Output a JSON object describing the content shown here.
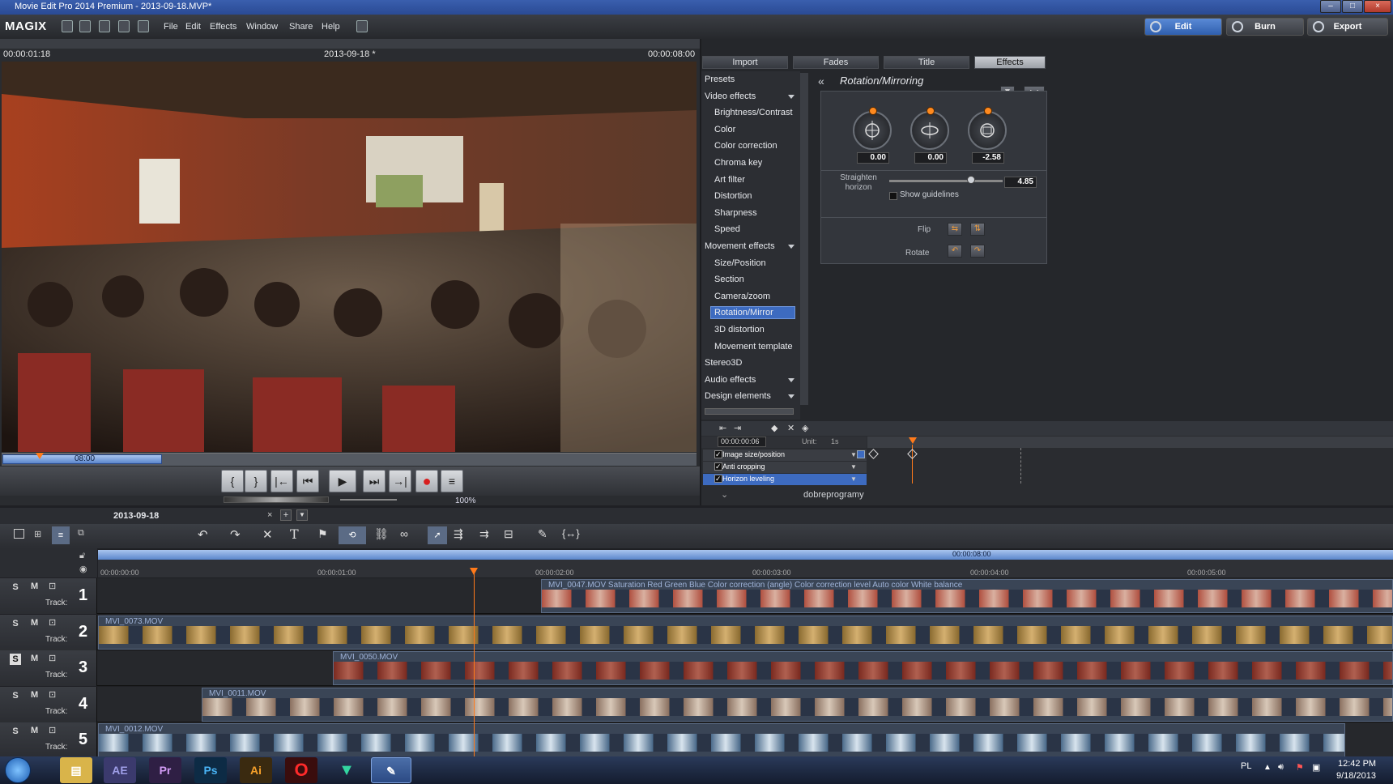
{
  "window": {
    "title": "Movie Edit Pro 2014 Premium - 2013-09-18.MVP*"
  },
  "menubar": {
    "logo": "MAGIX",
    "items": [
      "File",
      "Edit",
      "Effects",
      "Window",
      "Share",
      "Help"
    ],
    "modes": [
      {
        "label": "Edit",
        "active": true
      },
      {
        "label": "Burn",
        "active": false
      },
      {
        "label": "Export",
        "active": false
      }
    ]
  },
  "preview": {
    "time_current": "00:00:01:18",
    "project_title": "2013-09-18 *",
    "time_total": "00:00:08:00",
    "range_label": "08:00",
    "zoom": "100%"
  },
  "transport": {
    "buttons": [
      "{",
      "}",
      "|←",
      "⏮",
      "▶",
      "⏭",
      "→|",
      "●",
      "≡"
    ]
  },
  "tabs": [
    {
      "label": "Import"
    },
    {
      "label": "Fades"
    },
    {
      "label": "Title"
    },
    {
      "label": "Effects",
      "active": true
    }
  ],
  "effects_list": [
    {
      "label": "Presets",
      "type": "header"
    },
    {
      "label": "Video effects",
      "type": "header"
    },
    {
      "label": "Brightness/Contrast",
      "type": "item"
    },
    {
      "label": "Color",
      "type": "item"
    },
    {
      "label": "Color correction",
      "type": "item"
    },
    {
      "label": "Chroma key",
      "type": "item"
    },
    {
      "label": "Art filter",
      "type": "item"
    },
    {
      "label": "Distortion",
      "type": "item"
    },
    {
      "label": "Sharpness",
      "type": "item"
    },
    {
      "label": "Speed",
      "type": "item"
    },
    {
      "label": "Movement effects",
      "type": "header"
    },
    {
      "label": "Size/Position",
      "type": "item"
    },
    {
      "label": "Section",
      "type": "item"
    },
    {
      "label": "Camera/zoom",
      "type": "item"
    },
    {
      "label": "Rotation/Mirror",
      "type": "item",
      "selected": true
    },
    {
      "label": "3D distortion",
      "type": "item"
    },
    {
      "label": "Movement template",
      "type": "item"
    },
    {
      "label": "Stereo3D",
      "type": "header"
    },
    {
      "label": "Audio effects",
      "type": "header"
    },
    {
      "label": "Design elements",
      "type": "header"
    }
  ],
  "rotation_panel": {
    "title": "Rotation/Mirroring",
    "dials": [
      {
        "value": "0.00"
      },
      {
        "value": "0.00"
      },
      {
        "value": "-2.58"
      }
    ],
    "straighten_label": "Straighten horizon",
    "straighten_value": "4.85",
    "straighten_level": 0.72,
    "show_guidelines": "Show guidelines",
    "flip_label": "Flip",
    "rotate_label": "Rotate"
  },
  "keyframes": {
    "time": "00:00:00:06",
    "unit_label": "Unit:",
    "unit_value": "1s",
    "rows": [
      {
        "label": "Image size/position"
      },
      {
        "label": "Anti cropping"
      },
      {
        "label": "Horizon leveling",
        "selected": true
      }
    ],
    "footer_text": "dobreprogramy"
  },
  "timeline": {
    "project_tab": "2013-09-18",
    "ruler_top": "00:00:08:00",
    "ruler": [
      "00:00:00:00",
      "00:00:01:00",
      "00:00:02:00",
      "00:00:03:00",
      "00:00:04:00",
      "00:00:05:00"
    ],
    "tracks": [
      {
        "num": "1",
        "label": "Track:",
        "clip": "MVI_0047.MOV   Saturation   Red   Green   Blue   Color correction (angle)   Color correction level   Auto color   White balance"
      },
      {
        "num": "2",
        "label": "Track:",
        "clip": "MVI_0073.MOV"
      },
      {
        "num": "3",
        "label": "Track:",
        "clip": "MVI_0050.MOV"
      },
      {
        "num": "4",
        "label": "Track:",
        "clip": "MVI_0011.MOV"
      },
      {
        "num": "5",
        "label": "Track:",
        "clip": "MVI_0012.MOV"
      }
    ]
  },
  "taskbar": {
    "lang": "PL",
    "time": "12:42 PM",
    "date": "9/18/2013",
    "apps": [
      "AE",
      "Pr",
      "Ps",
      "Ai"
    ]
  },
  "colors": {
    "accent": "#3d6bc0",
    "playhead": "#ff7a1a",
    "record": "#d81e1e"
  }
}
